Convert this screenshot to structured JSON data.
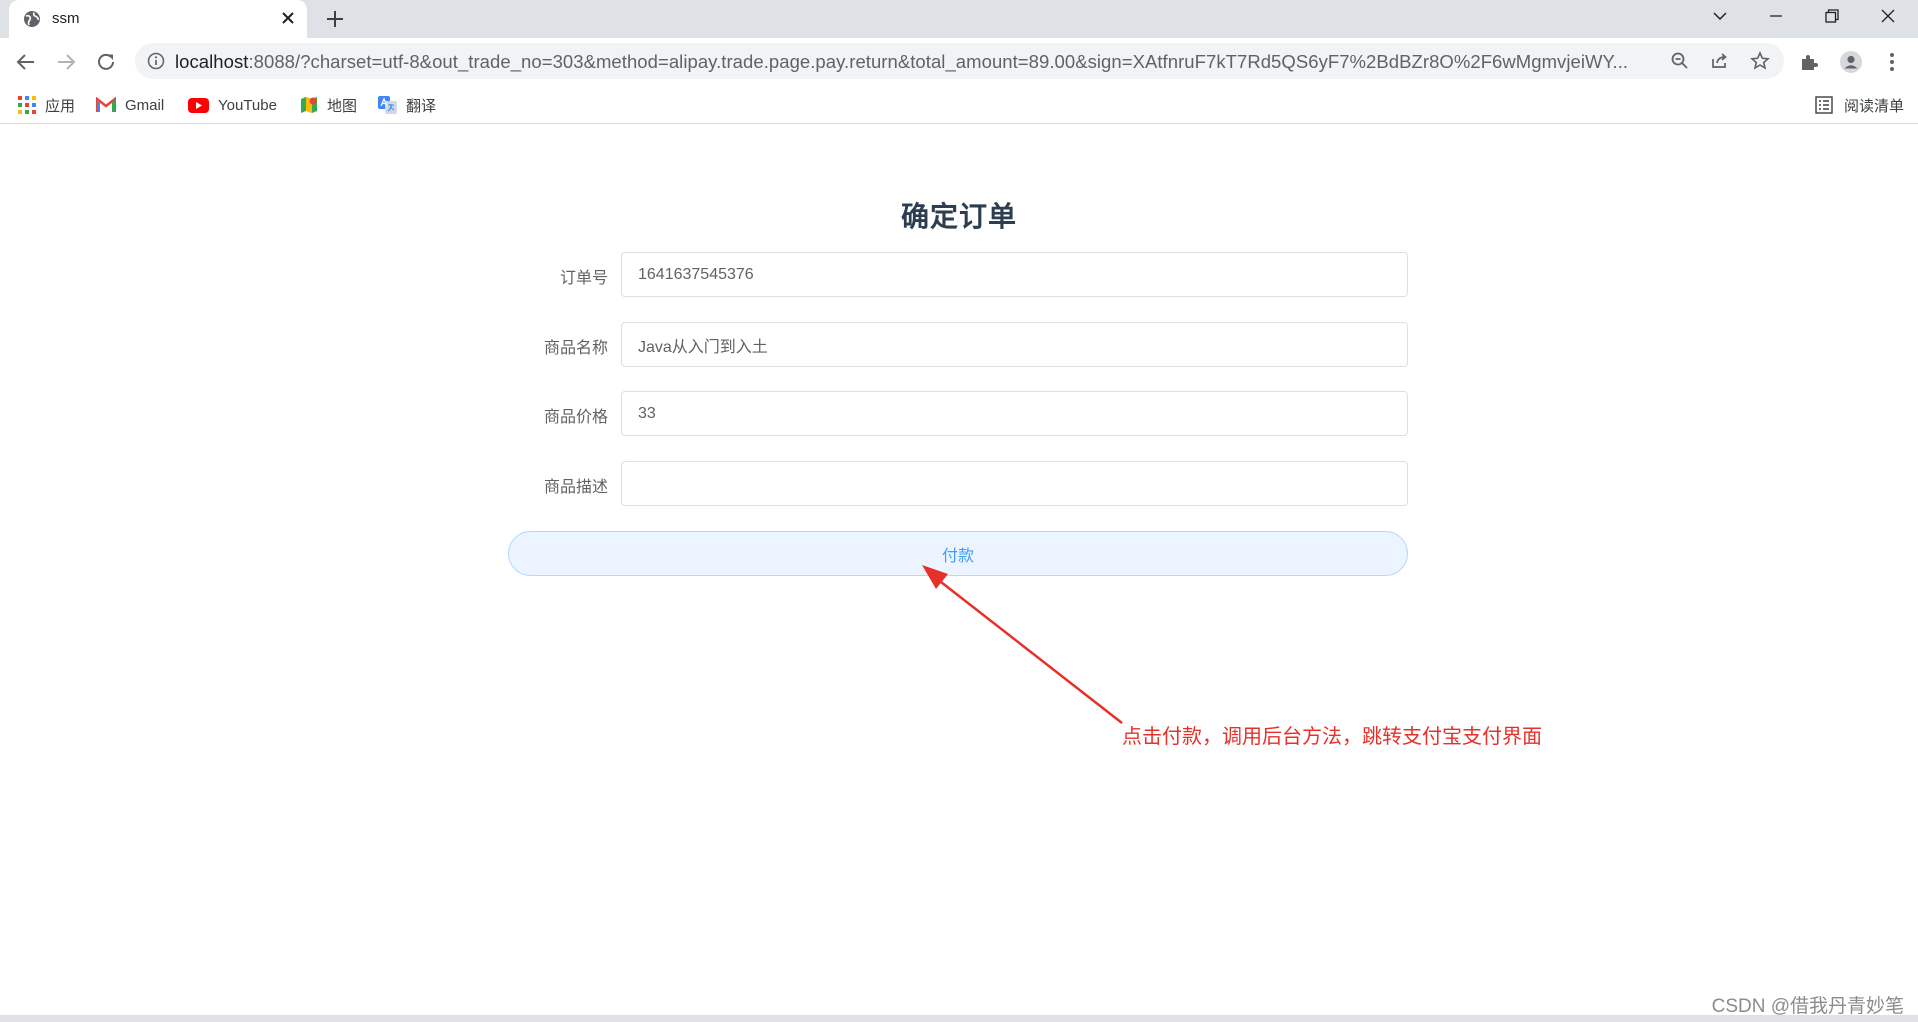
{
  "browser": {
    "tab": {
      "title": "ssm"
    },
    "address_bar": {
      "url_host": "localhost",
      "url_rest": ":8088/?charset=utf-8&out_trade_no=303&method=alipay.trade.page.pay.return&total_amount=89.00&sign=XAtfnruF7kT7Rd5QS6yF7%2BdBZr8O%2F6wMgmvjeiWY..."
    },
    "bookmarks": [
      {
        "label": "应用",
        "icon": "apps-grid-icon"
      },
      {
        "label": "Gmail",
        "icon": "gmail-icon"
      },
      {
        "label": "YouTube",
        "icon": "youtube-icon"
      },
      {
        "label": "地图",
        "icon": "maps-icon"
      },
      {
        "label": "翻译",
        "icon": "translate-icon"
      }
    ],
    "reading_list": {
      "label": "阅读清单",
      "icon": "reading-list-icon"
    }
  },
  "page": {
    "title": "确定订单",
    "fields": [
      {
        "label": "订单号",
        "value": "1641637545376"
      },
      {
        "label": "商品名称",
        "value": "Java从入门到入土"
      },
      {
        "label": "商品价格",
        "value": "33"
      },
      {
        "label": "商品描述",
        "value": ""
      }
    ],
    "pay_button": "付款"
  },
  "annotation": {
    "text": "点击付款，调用后台方法，跳转支付宝支付界面",
    "color": "#e8302a"
  },
  "watermark": "CSDN @借我丹青妙笔",
  "colors": {
    "primary": "#409eff",
    "button_bg": "#ecf5ff",
    "title": "#2c3e50"
  }
}
